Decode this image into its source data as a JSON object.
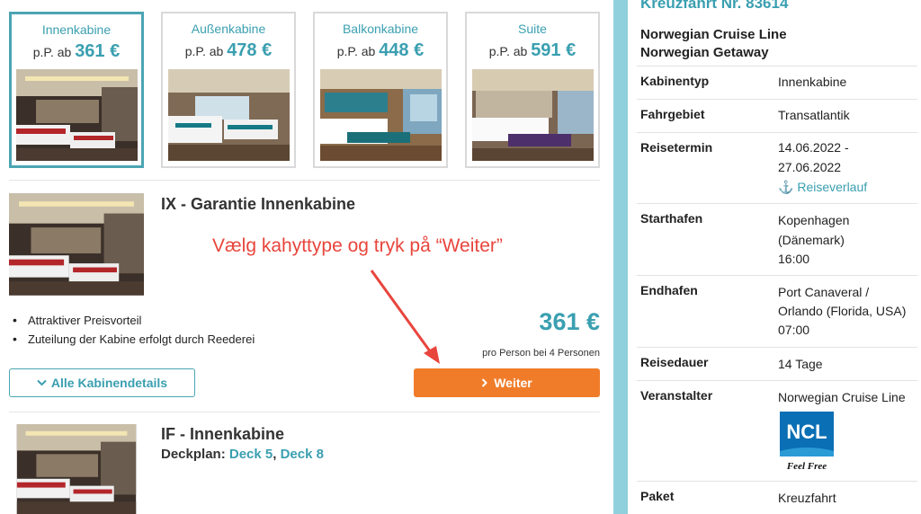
{
  "cabin_types": [
    {
      "name": "Innenkabine",
      "prefix": "p.P. ab",
      "price": "361 €",
      "selected": true
    },
    {
      "name": "Außenkabine",
      "prefix": "p.P. ab",
      "price": "478 €",
      "selected": false
    },
    {
      "name": "Balkonkabine",
      "prefix": "p.P. ab",
      "price": "448 €",
      "selected": false
    },
    {
      "name": "Suite",
      "prefix": "p.P. ab",
      "price": "591 €",
      "selected": false
    }
  ],
  "offer1": {
    "title": "IX - Garantie Innenkabine",
    "bullets": [
      "Attraktiver Preisvorteil",
      "Zuteilung der Kabine erfolgt durch Reederei"
    ],
    "price": "361 €",
    "price_note": "pro Person bei 4 Personen",
    "details_button": "Alle Kabinendetails",
    "next_button": "Weiter"
  },
  "annotation": "Vælg kahyttype og tryk på “Weiter”",
  "offer2": {
    "title": "IF - Innenkabine",
    "deckplan_label": "Deckplan:",
    "decks": [
      "Deck 5",
      "Deck 8"
    ],
    "deck_separator": ","
  },
  "panel": {
    "heading": "Kreuzfahrt Nr. 83614",
    "line1": "Norwegian Cruise Line",
    "line2": "Norwegian Getaway",
    "rows": [
      {
        "label": "Kabinentyp",
        "value": [
          "Innenkabine"
        ]
      },
      {
        "label": "Fahrgebiet",
        "value": [
          "Transatlantik"
        ]
      },
      {
        "label": "Reisetermin",
        "value": [
          "14.06.2022 -",
          "27.06.2022"
        ],
        "link": "Reiseverlauf"
      },
      {
        "label": "Starthafen",
        "value": [
          "Kopenhagen",
          "(Dänemark)",
          "16:00"
        ]
      },
      {
        "label": "Endhafen",
        "value": [
          "Port Canaveral /",
          "Orlando (Florida, USA)",
          "07:00"
        ]
      },
      {
        "label": "Reisedauer",
        "value": [
          "14 Tage"
        ]
      },
      {
        "label": "Veranstalter",
        "value": [
          "Norwegian Cruise Line"
        ]
      },
      {
        "label": "Paket",
        "value": [
          "Kreuzfahrt"
        ]
      }
    ],
    "logo": {
      "text": "NCL",
      "tagline": "Feel Free",
      "icon": "ncl-logo-icon"
    }
  },
  "colors": {
    "accent": "#3a9fb0",
    "orange": "#f07c2a",
    "teal_bar": "#8fd0dc",
    "annotation": "#e8453c"
  }
}
